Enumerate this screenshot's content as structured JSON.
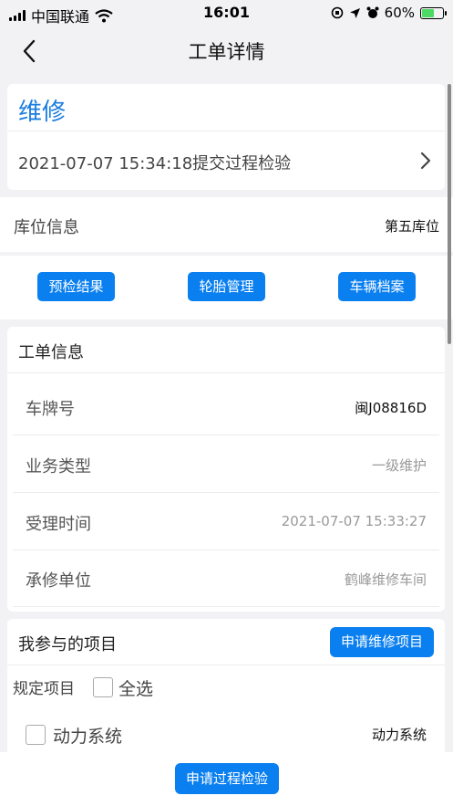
{
  "status_bar": {
    "carrier": "中国联通",
    "time": "16:01",
    "battery": "60%",
    "battery_level": 0.6
  },
  "nav": {
    "title": "工单详情"
  },
  "order": {
    "type": "维修",
    "process": "2021-07-07 15:34:18提交过程检验"
  },
  "bay": {
    "label": "库位信息",
    "value": "第五库位"
  },
  "actions": {
    "precheck": "预检结果",
    "tire": "轮胎管理",
    "vehicle_file": "车辆档案"
  },
  "info": {
    "header": "工单信息",
    "rows": [
      {
        "label": "车牌号",
        "value": "闽J08816D"
      },
      {
        "label": "业务类型",
        "value": "一级维护"
      },
      {
        "label": "受理时间",
        "value": "2021-07-07 15:33:27"
      },
      {
        "label": "承修单位",
        "value": "鹤峰维修车间"
      }
    ]
  },
  "projects": {
    "title": "我参与的项目",
    "apply_button": "申请维修项目",
    "spec_label": "规定项目",
    "select_all": "全选",
    "items": [
      {
        "label": "动力系统",
        "value": "动力系统"
      }
    ]
  },
  "bottom": {
    "submit_button": "申请过程检验"
  },
  "colors": {
    "accent": "#0a7ff0",
    "title_blue": "#1a7de0"
  }
}
